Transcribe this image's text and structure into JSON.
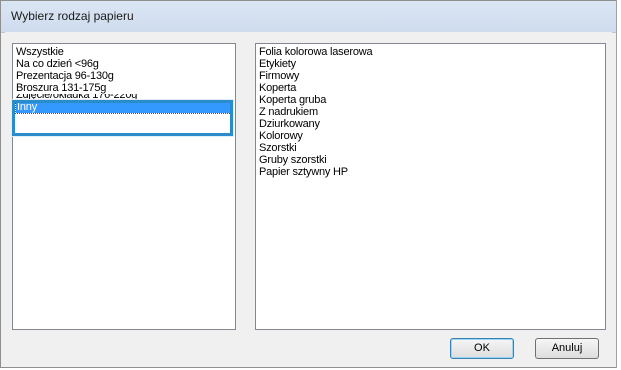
{
  "dialog": {
    "title": "Wybierz rodzaj papieru"
  },
  "left_list": {
    "items": [
      "Wszystkie",
      "Na co dzień <96g",
      "Prezentacja 96-130g",
      "Broszura 131-175g",
      "Zdjęcie/okładka 176-220g",
      "Inny"
    ],
    "selected": "Inny"
  },
  "right_list": {
    "items": [
      "Folia kolorowa laserowa",
      "Etykiety",
      "Firmowy",
      "Koperta",
      "Koperta gruba",
      "Z nadrukiem",
      "Dziurkowany",
      "Kolorowy",
      "Szorstki",
      "Gruby szorstki",
      "Papier sztywny HP"
    ]
  },
  "buttons": {
    "ok": "OK",
    "cancel": "Anuluj"
  },
  "colors": {
    "selection": "#3399ff",
    "callout": "#2a8ccb"
  }
}
